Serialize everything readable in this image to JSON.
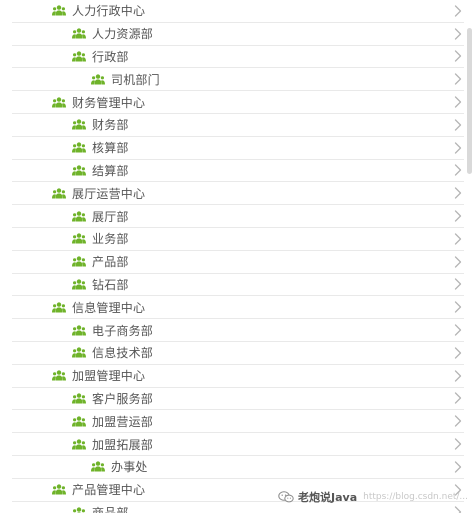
{
  "tree": {
    "rows": [
      {
        "label": "人力行政中心",
        "level": 0
      },
      {
        "label": "人力资源部",
        "level": 1
      },
      {
        "label": "行政部",
        "level": 1
      },
      {
        "label": "司机部门",
        "level": 2
      },
      {
        "label": "财务管理中心",
        "level": 0
      },
      {
        "label": "财务部",
        "level": 1
      },
      {
        "label": "核算部",
        "level": 1
      },
      {
        "label": "结算部",
        "level": 1
      },
      {
        "label": "展厅运营中心",
        "level": 0
      },
      {
        "label": "展厅部",
        "level": 1
      },
      {
        "label": "业务部",
        "level": 1
      },
      {
        "label": "产品部",
        "level": 1
      },
      {
        "label": "钻石部",
        "level": 1
      },
      {
        "label": "信息管理中心",
        "level": 0
      },
      {
        "label": "电子商务部",
        "level": 1
      },
      {
        "label": "信息技术部",
        "level": 1
      },
      {
        "label": "加盟管理中心",
        "level": 0
      },
      {
        "label": "客户服务部",
        "level": 1
      },
      {
        "label": "加盟营运部",
        "level": 1
      },
      {
        "label": "加盟拓展部",
        "level": 1
      },
      {
        "label": "办事处",
        "level": 2
      },
      {
        "label": "产品管理中心",
        "level": 0
      },
      {
        "label": "商品部",
        "level": 1
      }
    ]
  },
  "icons": {
    "row_icon": "users-group-icon",
    "row_icon_color": "#6fb32a",
    "chevron": "chevron-right-icon",
    "chevron_color": "#b5b5b5"
  },
  "watermark": {
    "text": "老炮说Java",
    "faint": "https://blog.csdn.net/...",
    "logo": "wechat-icon"
  }
}
